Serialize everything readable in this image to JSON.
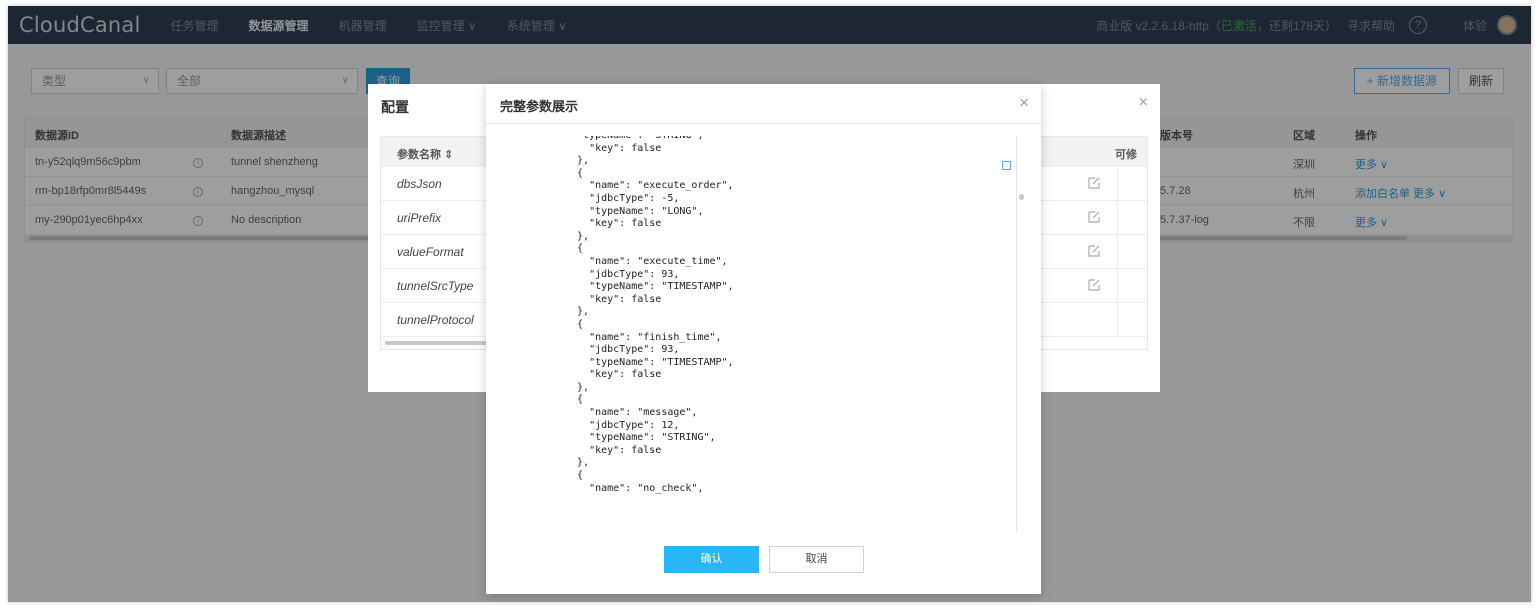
{
  "app": {
    "logo": "CloudCanal",
    "nav": [
      {
        "label": "任务管理",
        "active": false
      },
      {
        "label": "数据源管理",
        "active": true
      },
      {
        "label": "机器管理",
        "active": false
      },
      {
        "label": "监控管理 ∨",
        "active": false
      },
      {
        "label": "系统管理 ∨",
        "active": false
      }
    ],
    "version_text": "商业版 v2.2.6.18-http（",
    "license_status": "已激活",
    "remaining_text": "，还剩178天）",
    "help_label": "寻求帮助",
    "help_icon": "?",
    "user_label": "体验"
  },
  "filters": {
    "type_select": "类型",
    "all_select": "全部",
    "query_button": "查询",
    "add_button": "+ 新增数据源",
    "refresh_button": "刷新"
  },
  "table": {
    "columns": [
      "数据源ID",
      "数据源描述",
      "版本号",
      "区域",
      "操作"
    ],
    "rows": [
      {
        "id": "tn-y52qlq9m56c9pbm",
        "desc": "tunnel shenzheng",
        "version": "",
        "region": "深圳",
        "actions": "更多 ∨"
      },
      {
        "id": "rm-bp18rfp0mr8l5449s",
        "desc": "hangzhou_mysql",
        "version": "5.7.28",
        "region": "杭州",
        "actions": "添加白名单   更多 ∨"
      },
      {
        "id": "my-290p01yec6hp4xx",
        "desc": "No description",
        "version": "5.7.37-log",
        "region": "不限",
        "actions": "更多 ∨"
      }
    ]
  },
  "config_modal": {
    "title": "配置",
    "close": "×",
    "head_name": "参数名称 ⇕",
    "head_right": "可修",
    "params": [
      "dbsJson",
      "uriPrefix",
      "valueFormat",
      "tunnelSrcType",
      "tunnelProtocol"
    ]
  },
  "detail_modal": {
    "title": "完整参数展示",
    "close": "×",
    "code": "  \"typeName\": \"STRING\",\n    \"key\": false\n  },\n  {\n    \"name\": \"execute_order\",\n    \"jdbcType\": -5,\n    \"typeName\": \"LONG\",\n    \"key\": false\n  },\n  {\n    \"name\": \"execute_time\",\n    \"jdbcType\": 93,\n    \"typeName\": \"TIMESTAMP\",\n    \"key\": false\n  },\n  {\n    \"name\": \"finish_time\",\n    \"jdbcType\": 93,\n    \"typeName\": \"TIMESTAMP\",\n    \"key\": false\n  },\n  {\n    \"name\": \"message\",\n    \"jdbcType\": 12,\n    \"typeName\": \"STRING\",\n    \"key\": false\n  },\n  {\n    \"name\": \"no_check\",",
    "confirm": "确认",
    "cancel": "取消"
  },
  "colors": {
    "header_bg": "#2f4054",
    "primary": "#29b6f6",
    "link": "#2d9cdb"
  }
}
